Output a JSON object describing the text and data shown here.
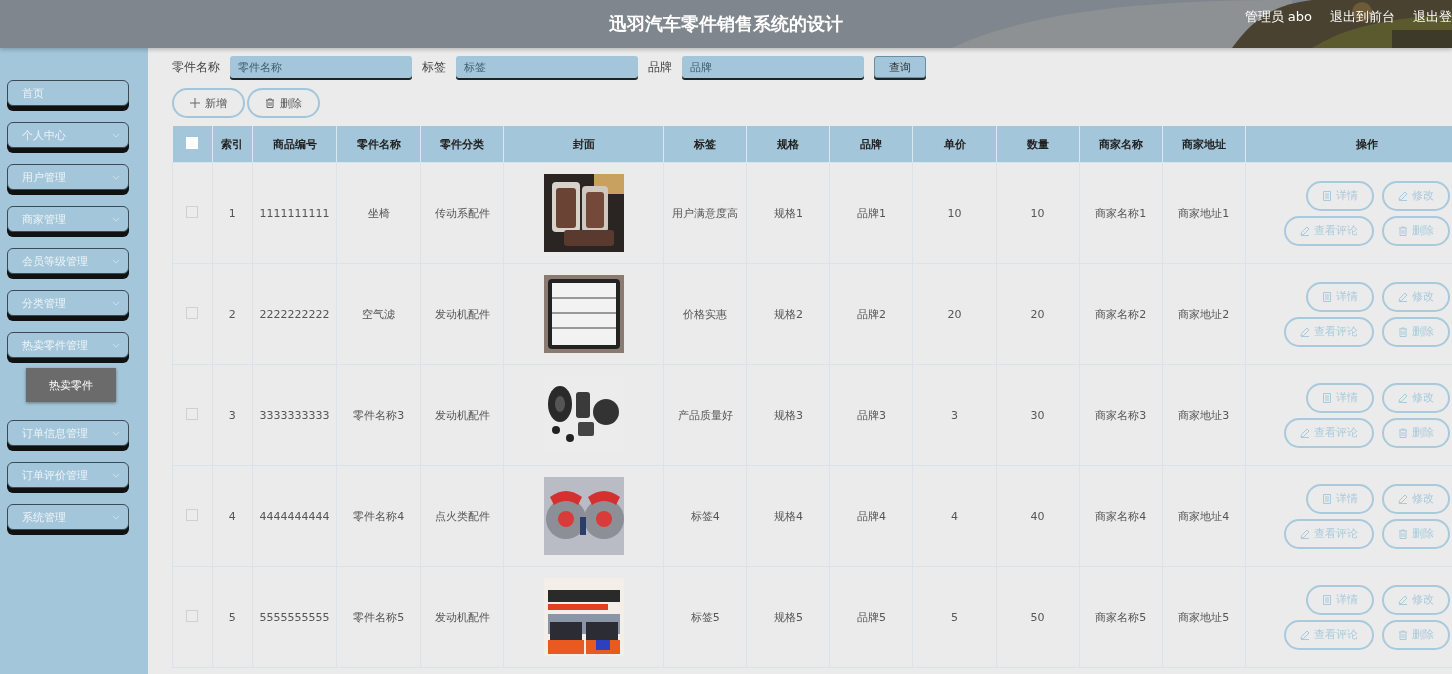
{
  "header": {
    "title": "迅羽汽车零件销售系统的设计",
    "links": [
      "管理员 abo",
      "退出到前台",
      "退出登"
    ]
  },
  "sidebar": {
    "items": [
      {
        "label": "首页",
        "kind": "link"
      },
      {
        "label": "个人中心",
        "kind": "submenu"
      },
      {
        "label": "用户管理",
        "kind": "submenu"
      },
      {
        "label": "商家管理",
        "kind": "submenu"
      },
      {
        "label": "会员等级管理",
        "kind": "submenu"
      },
      {
        "label": "分类管理",
        "kind": "submenu"
      },
      {
        "label": "热卖零件管理",
        "kind": "submenu",
        "children": [
          {
            "label": "热卖零件",
            "selected": true
          }
        ]
      },
      {
        "label": "订单信息管理",
        "kind": "submenu"
      },
      {
        "label": "订单评价管理",
        "kind": "submenu"
      },
      {
        "label": "系统管理",
        "kind": "submenu"
      }
    ]
  },
  "search": {
    "fields": [
      {
        "label": "零件名称",
        "placeholder": "零件名称"
      },
      {
        "label": "标签",
        "placeholder": "标签"
      },
      {
        "label": "品牌",
        "placeholder": "品牌"
      }
    ],
    "button": "查询"
  },
  "toolbar": [
    {
      "label": "新增",
      "kind": "add"
    },
    {
      "label": "删除",
      "kind": "delete"
    }
  ],
  "table": {
    "select_all": {
      "checked": false
    },
    "columns": [
      "索引",
      "商品编号",
      "零件名称",
      "零件分类",
      "封面",
      "标签",
      "规格",
      "品牌",
      "单价",
      "数量",
      "商家名称",
      "商家地址",
      "操作"
    ],
    "rows": [
      {
        "checked": false,
        "cells": [
          "1",
          "1111111111",
          "坐椅",
          "传动系配件",
          {
            "kind": "picture"
          },
          "用户满意度高",
          "规格1",
          "品牌1",
          "10",
          "10",
          "商家名称1",
          "商家地址1"
        ],
        "actions": [
          {
            "label": "详情",
            "kind": "doc"
          },
          {
            "label": "修改",
            "kind": "edit"
          },
          {
            "label": "查看评论",
            "kind": "edit"
          },
          {
            "label": "删除",
            "kind": "delete"
          }
        ]
      },
      {
        "checked": false,
        "cells": [
          "2",
          "2222222222",
          "空气滤",
          "发动机配件",
          {
            "kind": "picture"
          },
          "价格实惠",
          "规格2",
          "品牌2",
          "20",
          "20",
          "商家名称2",
          "商家地址2"
        ],
        "actions": [
          {
            "label": "详情",
            "kind": "doc"
          },
          {
            "label": "修改",
            "kind": "edit"
          },
          {
            "label": "查看评论",
            "kind": "edit"
          },
          {
            "label": "删除",
            "kind": "delete"
          }
        ]
      },
      {
        "checked": false,
        "cells": [
          "3",
          "3333333333",
          "零件名称3",
          "发动机配件",
          {
            "kind": "picture"
          },
          "产品质量好",
          "规格3",
          "品牌3",
          "3",
          "30",
          "商家名称3",
          "商家地址3"
        ],
        "actions": [
          {
            "label": "详情",
            "kind": "doc"
          },
          {
            "label": "修改",
            "kind": "edit"
          },
          {
            "label": "查看评论",
            "kind": "edit"
          },
          {
            "label": "删除",
            "kind": "delete"
          }
        ]
      },
      {
        "checked": false,
        "cells": [
          "4",
          "4444444444",
          "零件名称4",
          "点火类配件",
          {
            "kind": "picture"
          },
          "标签4",
          "规格4",
          "品牌4",
          "4",
          "40",
          "商家名称4",
          "商家地址4"
        ],
        "actions": [
          {
            "label": "详情",
            "kind": "doc"
          },
          {
            "label": "修改",
            "kind": "edit"
          },
          {
            "label": "查看评论",
            "kind": "edit"
          },
          {
            "label": "删除",
            "kind": "delete"
          }
        ]
      },
      {
        "checked": false,
        "cells": [
          "5",
          "5555555555",
          "零件名称5",
          "发动机配件",
          {
            "kind": "picture"
          },
          "标签5",
          "规格5",
          "品牌5",
          "5",
          "50",
          "商家名称5",
          "商家地址5"
        ],
        "actions": [
          {
            "label": "详情",
            "kind": "doc"
          },
          {
            "label": "修改",
            "kind": "edit"
          },
          {
            "label": "查看评论",
            "kind": "edit"
          },
          {
            "label": "删除",
            "kind": "delete"
          }
        ]
      }
    ]
  }
}
